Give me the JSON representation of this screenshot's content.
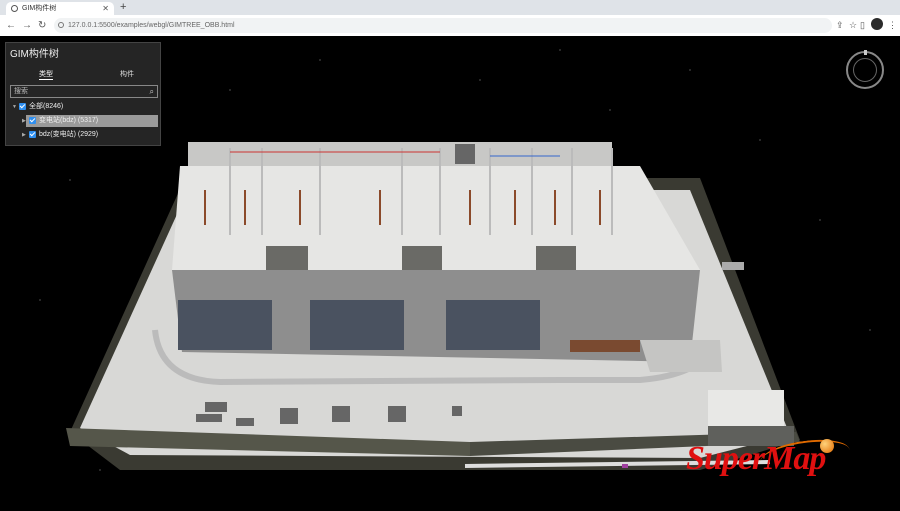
{
  "browser": {
    "tab_title": "GIM构件树",
    "url": "127.0.0.1:5500/examples/webgl/GIMTREE_OBB.html"
  },
  "panel": {
    "title": "GIM构件树",
    "tabs": [
      {
        "label": "类型",
        "active": true
      },
      {
        "label": "构件",
        "active": false
      }
    ],
    "search_placeholder": "搜索",
    "tree": [
      {
        "label": "全部(8246)",
        "level": 0,
        "expanded": true,
        "checked": true
      },
      {
        "label": "变电站(bdz) (5317)",
        "level": 1,
        "expanded": false,
        "checked": true,
        "highlighted": true
      },
      {
        "label": "bdz(变电站) (2929)",
        "level": 1,
        "expanded": false,
        "checked": true
      }
    ]
  },
  "logo": {
    "text": "SuperMap"
  },
  "colors": {
    "accent": "#2f8ff0",
    "logo": "#e01010"
  }
}
